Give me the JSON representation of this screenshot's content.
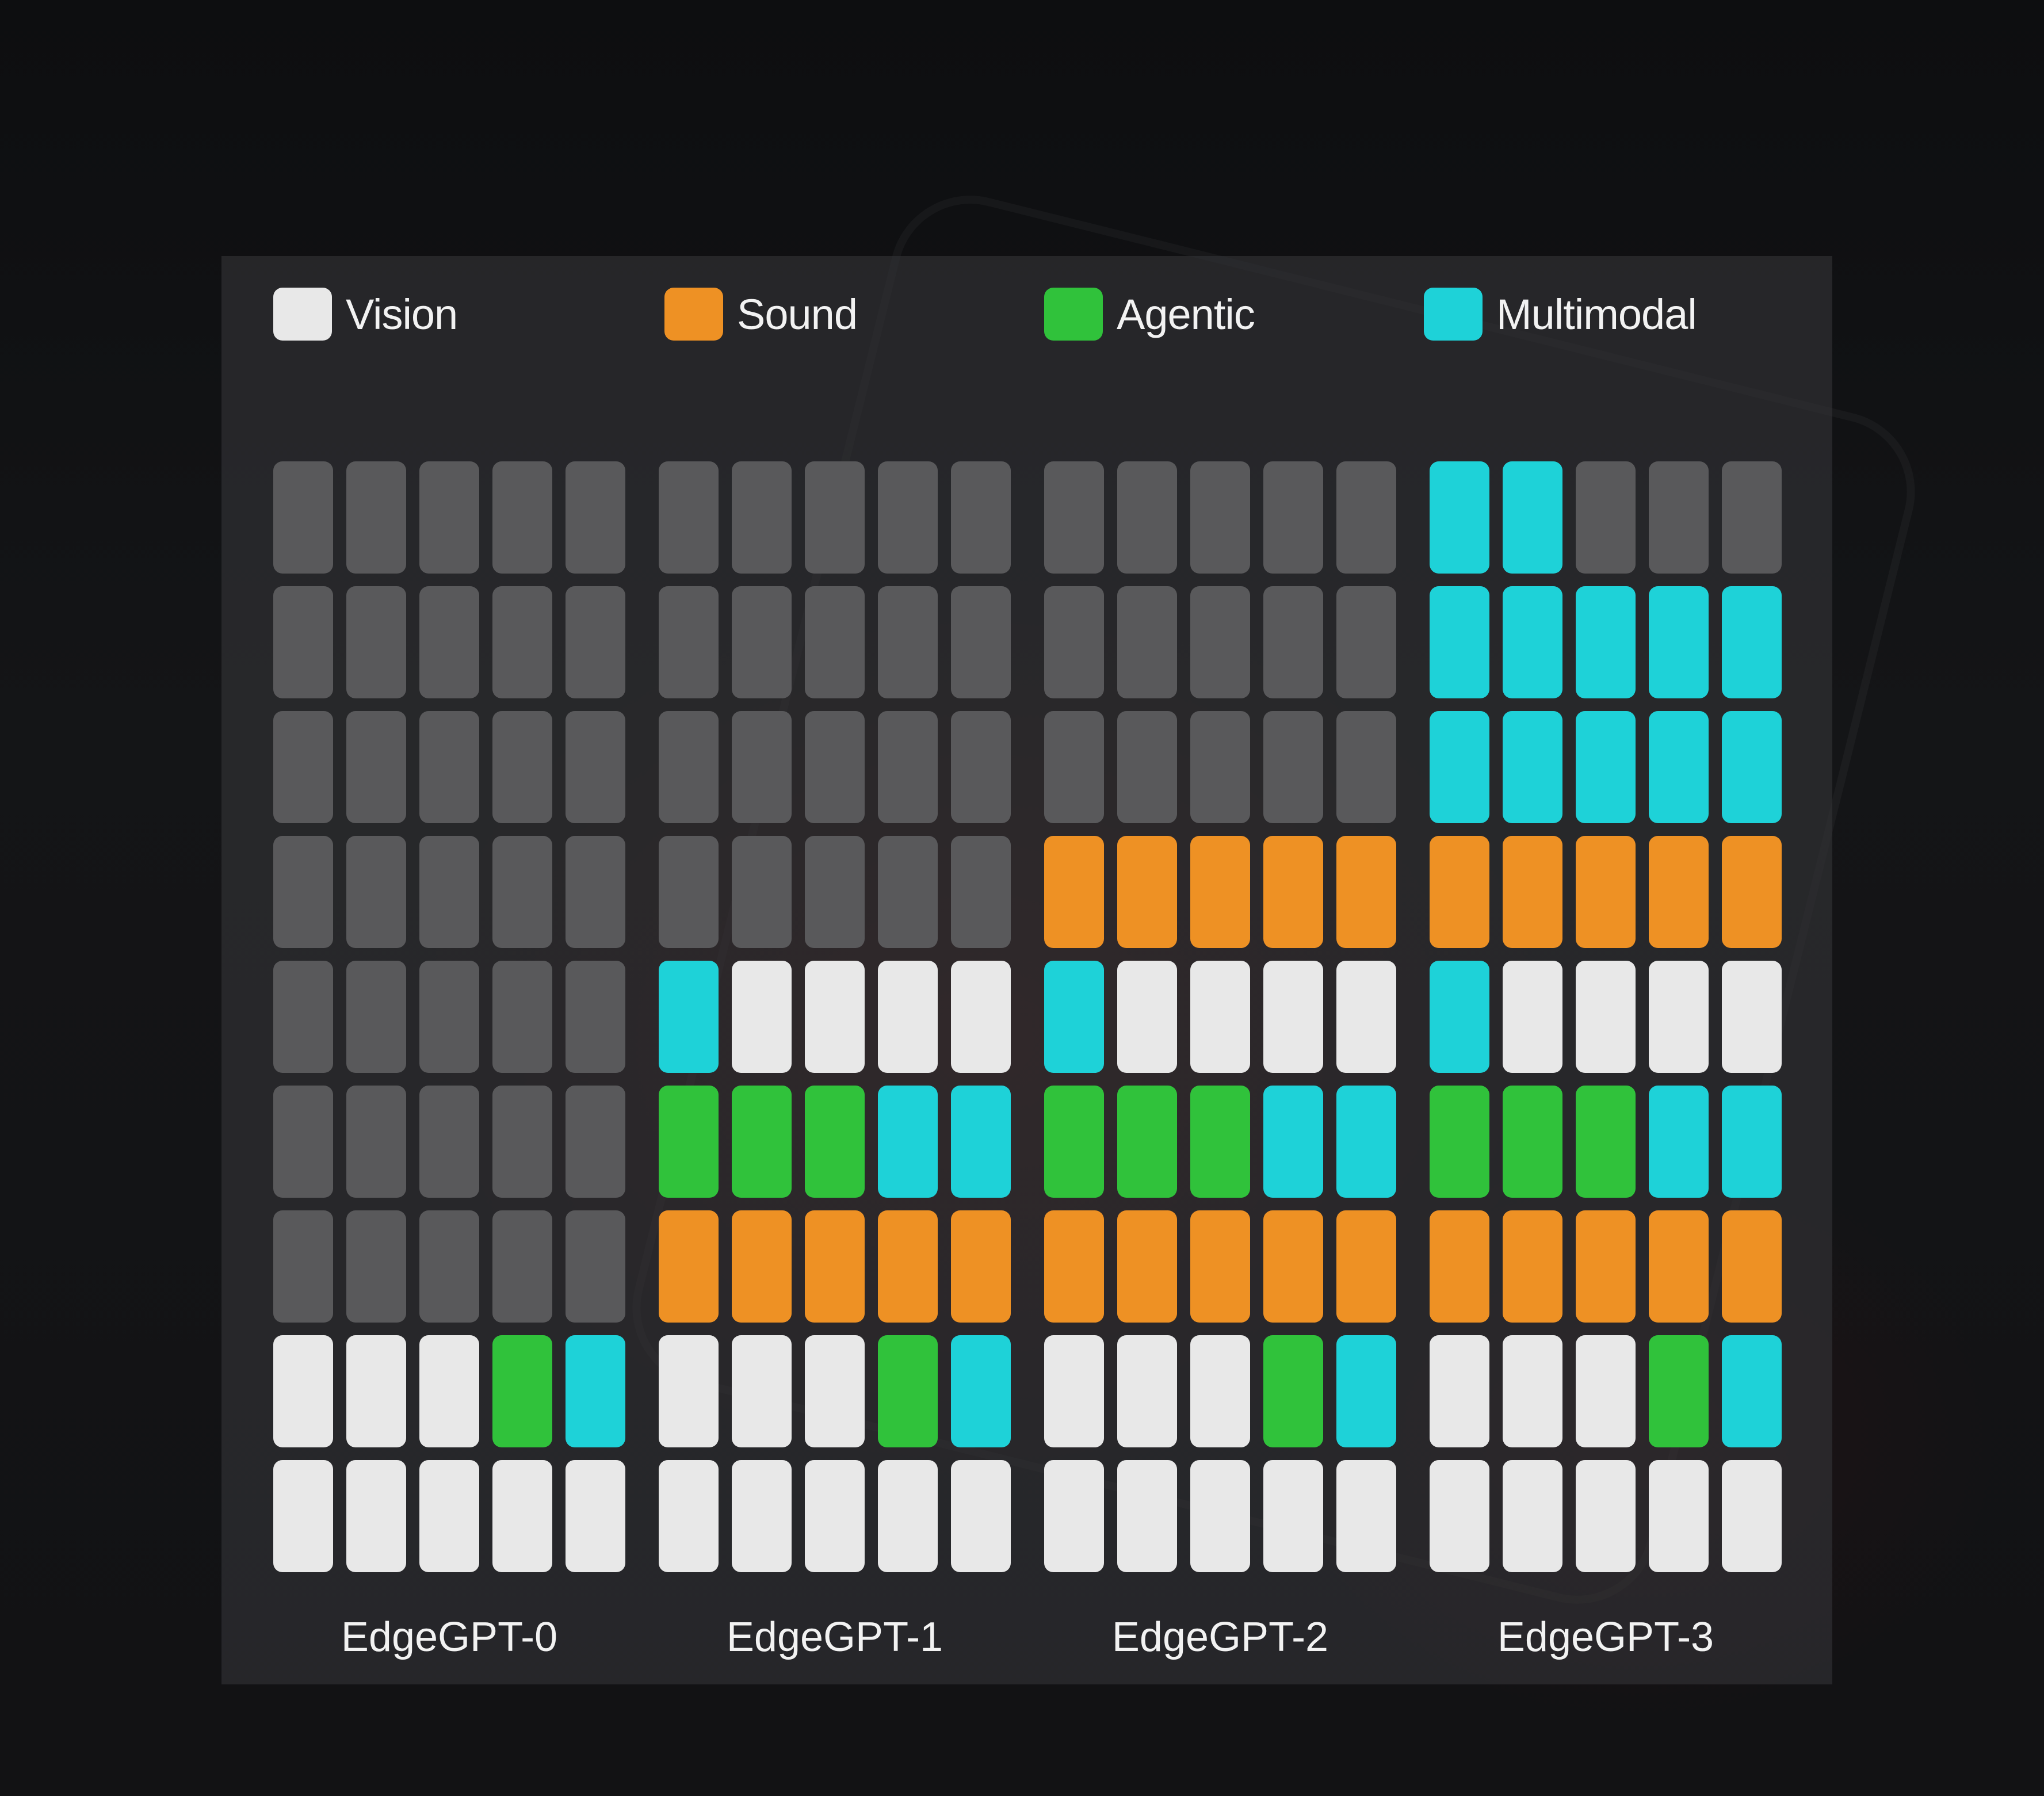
{
  "colors": {
    "Vision": "#e8e8e8",
    "Sound": "#ee9124",
    "Agentic": "#30c23b",
    "Multimodal": "#1ed2d8",
    "Empty": "#59595b"
  },
  "legend": [
    {
      "name": "Vision",
      "color": "#e8e8e8"
    },
    {
      "name": "Sound",
      "color": "#ee9124"
    },
    {
      "name": "Agentic",
      "color": "#30c23b"
    },
    {
      "name": "Multimodal",
      "color": "#1ed2d8"
    }
  ],
  "chart_data": {
    "type": "heatmap",
    "categories": [
      "EdgeGPT-0",
      "EdgeGPT-1",
      "EdgeGPT-2",
      "EdgeGPT-3"
    ],
    "grid": {
      "rows": 9,
      "cols_per_group": 5
    },
    "legend_position": "top",
    "models": [
      {
        "name": "EdgeGPT-0",
        "rows": [
          [
            "Empty",
            "Empty",
            "Empty",
            "Empty",
            "Empty"
          ],
          [
            "Empty",
            "Empty",
            "Empty",
            "Empty",
            "Empty"
          ],
          [
            "Empty",
            "Empty",
            "Empty",
            "Empty",
            "Empty"
          ],
          [
            "Empty",
            "Empty",
            "Empty",
            "Empty",
            "Empty"
          ],
          [
            "Empty",
            "Empty",
            "Empty",
            "Empty",
            "Empty"
          ],
          [
            "Empty",
            "Empty",
            "Empty",
            "Empty",
            "Empty"
          ],
          [
            "Empty",
            "Empty",
            "Empty",
            "Empty",
            "Empty"
          ],
          [
            "Vision",
            "Vision",
            "Vision",
            "Agentic",
            "Multimodal"
          ],
          [
            "Vision",
            "Vision",
            "Vision",
            "Vision",
            "Vision"
          ]
        ]
      },
      {
        "name": "EdgeGPT-1",
        "rows": [
          [
            "Empty",
            "Empty",
            "Empty",
            "Empty",
            "Empty"
          ],
          [
            "Empty",
            "Empty",
            "Empty",
            "Empty",
            "Empty"
          ],
          [
            "Empty",
            "Empty",
            "Empty",
            "Empty",
            "Empty"
          ],
          [
            "Empty",
            "Empty",
            "Empty",
            "Empty",
            "Empty"
          ],
          [
            "Multimodal",
            "Vision",
            "Vision",
            "Vision",
            "Vision"
          ],
          [
            "Agentic",
            "Agentic",
            "Agentic",
            "Multimodal",
            "Multimodal"
          ],
          [
            "Sound",
            "Sound",
            "Sound",
            "Sound",
            "Sound"
          ],
          [
            "Vision",
            "Vision",
            "Vision",
            "Agentic",
            "Multimodal"
          ],
          [
            "Vision",
            "Vision",
            "Vision",
            "Vision",
            "Vision"
          ]
        ]
      },
      {
        "name": "EdgeGPT-2",
        "rows": [
          [
            "Empty",
            "Empty",
            "Empty",
            "Empty",
            "Empty"
          ],
          [
            "Empty",
            "Empty",
            "Empty",
            "Empty",
            "Empty"
          ],
          [
            "Empty",
            "Empty",
            "Empty",
            "Empty",
            "Empty"
          ],
          [
            "Sound",
            "Sound",
            "Sound",
            "Sound",
            "Sound"
          ],
          [
            "Multimodal",
            "Vision",
            "Vision",
            "Vision",
            "Vision"
          ],
          [
            "Agentic",
            "Agentic",
            "Agentic",
            "Multimodal",
            "Multimodal"
          ],
          [
            "Sound",
            "Sound",
            "Sound",
            "Sound",
            "Sound"
          ],
          [
            "Vision",
            "Vision",
            "Vision",
            "Agentic",
            "Multimodal"
          ],
          [
            "Vision",
            "Vision",
            "Vision",
            "Vision",
            "Vision"
          ]
        ]
      },
      {
        "name": "EdgeGPT-3",
        "rows": [
          [
            "Multimodal",
            "Multimodal",
            "Empty",
            "Empty",
            "Empty"
          ],
          [
            "Multimodal",
            "Multimodal",
            "Multimodal",
            "Multimodal",
            "Multimodal"
          ],
          [
            "Multimodal",
            "Multimodal",
            "Multimodal",
            "Multimodal",
            "Multimodal"
          ],
          [
            "Sound",
            "Sound",
            "Sound",
            "Sound",
            "Sound"
          ],
          [
            "Multimodal",
            "Vision",
            "Vision",
            "Vision",
            "Vision"
          ],
          [
            "Agentic",
            "Agentic",
            "Agentic",
            "Multimodal",
            "Multimodal"
          ],
          [
            "Sound",
            "Sound",
            "Sound",
            "Sound",
            "Sound"
          ],
          [
            "Vision",
            "Vision",
            "Vision",
            "Agentic",
            "Multimodal"
          ],
          [
            "Vision",
            "Vision",
            "Vision",
            "Vision",
            "Vision"
          ]
        ]
      }
    ]
  }
}
